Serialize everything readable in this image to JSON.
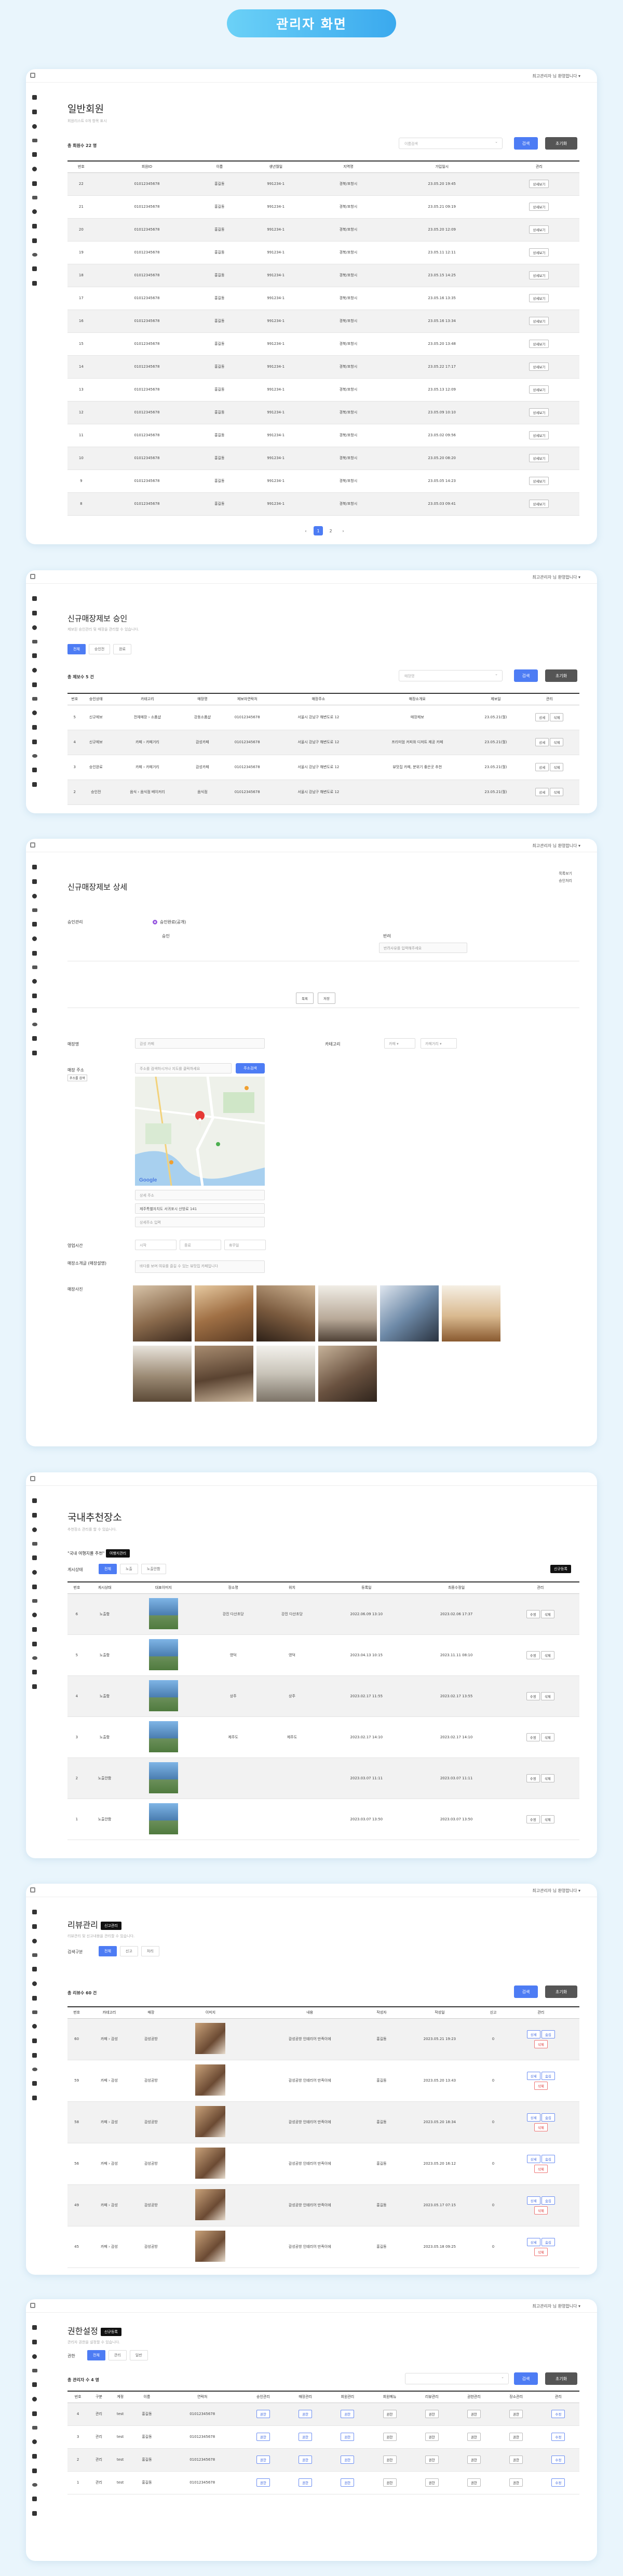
{
  "banner": "관리자 화면",
  "userinfo": "최고관리자 님 환영합니다 ▾",
  "s1": {
    "title": "일반회원",
    "sub": "회원리스트 0개 항목 표시",
    "total": "총 회원수 22 명",
    "search_placeholder": "이름검색",
    "search": "검색",
    "reset": "초기화",
    "cols": [
      "번호",
      "회원ID",
      "이름",
      "생년월일",
      "지역명",
      "가입일시",
      "관리"
    ],
    "rows": [
      [
        "22",
        "01012345678",
        "홍길동",
        "991234-1",
        "경북/포항시",
        "23.05.20 19:45"
      ],
      [
        "21",
        "01012345678",
        "홍길동",
        "991234-1",
        "경북/포항시",
        "23.05.21 09:19"
      ],
      [
        "20",
        "01012345678",
        "홍길동",
        "991234-1",
        "경북/포항시",
        "23.05.20 12:09"
      ],
      [
        "19",
        "01012345678",
        "홍길동",
        "991234-1",
        "경북/포항시",
        "23.05.11 12:11"
      ],
      [
        "18",
        "01012345678",
        "홍길동",
        "991234-1",
        "경북/포항시",
        "23.05.15 14:25"
      ],
      [
        "17",
        "01012345678",
        "홍길동",
        "991234-1",
        "경북/포항시",
        "23.05.16 13:35"
      ],
      [
        "16",
        "01012345678",
        "홍길동",
        "991234-1",
        "경북/포항시",
        "23.05.16 13:34"
      ],
      [
        "15",
        "01012345678",
        "홍길동",
        "991234-1",
        "경북/포항시",
        "23.05.20 13:48"
      ],
      [
        "14",
        "01012345678",
        "홍길동",
        "991234-1",
        "경북/포항시",
        "23.05.22 17:17"
      ],
      [
        "13",
        "01012345678",
        "홍길동",
        "991234-1",
        "경북/포항시",
        "23.05.13 12:09"
      ],
      [
        "12",
        "01012345678",
        "홍길동",
        "991234-1",
        "경북/포항시",
        "23.05.09 10:10"
      ],
      [
        "11",
        "01012345678",
        "홍길동",
        "991234-1",
        "경북/포항시",
        "23.05.02 09:56"
      ],
      [
        "10",
        "01012345678",
        "홍길동",
        "991234-1",
        "경북/포항시",
        "23.05.20 08:20"
      ],
      [
        "9",
        "01012345678",
        "홍길동",
        "991234-1",
        "경북/포항시",
        "23.05.05 14:23"
      ],
      [
        "8",
        "01012345678",
        "홍길동",
        "991234-1",
        "경북/포항시",
        "23.05.03 09:41"
      ]
    ],
    "action": "상세보기",
    "pages": [
      "‹",
      "1",
      "2",
      "›"
    ]
  },
  "s2": {
    "title": "신규매장제보 승인",
    "sub": "제보된 승인관리 및 매장을 관리할 수 있습니다.",
    "tabs": [
      "전체",
      "승인전",
      "완료"
    ],
    "total": "총 제보수 5 건",
    "search_placeholder": "매장명",
    "search": "검색",
    "reset": "초기화",
    "cols": [
      "번호",
      "승인상태",
      "카테고리",
      "매장명",
      "제보자연락처",
      "매장주소",
      "매장소개요",
      "제보일",
      "관리"
    ],
    "rows": [
      [
        "5",
        "신규제보",
        "전체매장 › 소품샵",
        "강동소품샵",
        "01012345678",
        "서울시 강남구 해변도로 12",
        "매장제보",
        "23.05.21(월)"
      ],
      [
        "4",
        "신규제보",
        "카페 › 카페거리",
        "감성카페",
        "01012345678",
        "서울시 강남구 해변도로 12",
        "프리미엄 커피와 디저트 제공 카페",
        "23.05.21(월)"
      ],
      [
        "3",
        "승인완료",
        "카페 › 카페거리",
        "감성카페",
        "01012345678",
        "서울시 강남구 해변도로 12",
        "뷰맛집 카페, 분위기 좋은곳 추천",
        "23.05.21(월)"
      ],
      [
        "2",
        "승인전",
        "음식 › 음식점 베이커리",
        "음식점",
        "01012345678",
        "서울시 강남구 해변도로 12",
        "",
        "23.05.21(월)"
      ]
    ],
    "b1": "상세",
    "b2": "삭제"
  },
  "s3": {
    "title": "신규매장제보 상세",
    "top_r1": "목록보기",
    "top_r2": "승인처리",
    "approve_label": "승인관리",
    "radio1": "승인완료(공개)",
    "radio2": "승인",
    "radio3": "반려",
    "reject_placeholder": "반려사유를 입력해주세요",
    "b_list": "목록",
    "b_save": "저장",
    "store_label": "매장명",
    "store_value": "감성 카페",
    "cat_label": "카테고리",
    "cat1": "카페 ▾",
    "cat2": "카페거리 ▾",
    "addr_label": "매장 주소",
    "addr_hint": "주소를 검색",
    "addr_placeholder": "주소를 검색하시거나 지도를 클릭하세요",
    "addr_btn": "주소검색",
    "addr1": "상세 주소",
    "addr2": "제주특별자치도 서귀포시 산방로 141",
    "addr3": "상세주소 입력",
    "time_label": "영업시간",
    "time1": "시작",
    "time2": "종료",
    "time3": "휴무일",
    "intro_label": "매장소개글 (매장설명)",
    "intro_value": "바다를 보며 여유를 즐길 수 있는 뷰맛집 카페입니다",
    "photo_label": "매장사진"
  },
  "s4": {
    "title": "국내추천장소",
    "sub": "추천장소 관리를 할 수 있습니다.",
    "note": "\"국내 여행지를 추천\"",
    "note_badge": "여행지관리",
    "filter_label": "게시상태",
    "tabs": [
      "전체",
      "노출",
      "노출안함"
    ],
    "add": "신규등록",
    "cols": [
      "번호",
      "게시상태",
      "대표이미지",
      "장소명",
      "위치",
      "등록일",
      "최종수정일",
      "관리"
    ],
    "rows": [
      [
        "6",
        "노출함",
        "강진 다산초당",
        "강진 다산초당",
        "2022.06.09 13:10",
        "2023.02.06 17:37"
      ],
      [
        "5",
        "노출함",
        "영덕",
        "영덕",
        "2023.04.13 10:15",
        "2023.11.11 08:10"
      ],
      [
        "4",
        "노출함",
        "상주",
        "상주",
        "2023.02.17 11:55",
        "2023.02.17 13:55"
      ],
      [
        "3",
        "노출함",
        "제주도",
        "제주도",
        "2023.02.17 14:10",
        "2023.02.17 14:10"
      ],
      [
        "2",
        "노출안함",
        "",
        "",
        "2023.03.07 11:11",
        "2023.03.07 11:11"
      ],
      [
        "1",
        "노출안함",
        "",
        "",
        "2023.03.07 13:50",
        "2023.03.07 13:50"
      ]
    ],
    "b1": "수정",
    "b2": "삭제"
  },
  "s5": {
    "title": "리뷰관리",
    "title_badge": "신고관리",
    "sub": "리뷰관리 및 신고내용을 관리할 수 있습니다.",
    "filter_label": "검색구분",
    "tabs": [
      "전체",
      "신고",
      "처리"
    ],
    "total": "총 리뷰수 60 건",
    "search": "검색",
    "reset": "초기화",
    "cols": [
      "번호",
      "카테고리",
      "매장",
      "이미지",
      "내용",
      "작성자",
      "작성일",
      "신고",
      "관리"
    ],
    "rows": [
      [
        "60",
        "카페 › 감성",
        "감성공방",
        "감성공방 인테리어 만족이에",
        "홍길동",
        "2023.05.21 19:23",
        "0"
      ],
      [
        "59",
        "카페 › 감성",
        "감성공방",
        "감성공방 인테리어 만족이에",
        "홍길동",
        "2023.05.20 13:43",
        "0"
      ],
      [
        "58",
        "카페 › 감성",
        "감성공방",
        "감성공방 인테리어 만족이에",
        "홍길동",
        "2023.05.20 18:34",
        "0"
      ],
      [
        "56",
        "카페 › 감성",
        "감성공방",
        "감성공방 인테리어 만족이에",
        "홍길동",
        "2023.05.20 16:12",
        "0"
      ],
      [
        "49",
        "카페 › 감성",
        "감성공방",
        "감성공방 인테리어 만족이에",
        "홍길동",
        "2023.05.17 07:15",
        "0"
      ],
      [
        "45",
        "카페 › 감성",
        "감성공방",
        "감성공방 인테리어 만족이에",
        "홍길동",
        "2023.05.18 09:25",
        "0"
      ]
    ],
    "b1": "상세",
    "b2": "숨김",
    "b3": "삭제"
  },
  "s6": {
    "title": "권한설정",
    "title_badge": "신규등록",
    "sub": "관리자 권한을 설정할 수 있습니다.",
    "filter_label": "권한",
    "tabs": [
      "전체",
      "관리",
      "일반"
    ],
    "total": "총 관리자 수 4 명",
    "search": "검색",
    "reset": "초기화",
    "cols": [
      "번호",
      "구분",
      "계정",
      "이름",
      "연락처",
      "승인관리",
      "매장관리",
      "회원관리",
      "회원메뉴",
      "리뷰관리",
      "권한관리",
      "장소관리",
      "관리"
    ],
    "rows": [
      [
        "4",
        "관리",
        "test",
        "홍길동",
        "01012345678"
      ],
      [
        "3",
        "관리",
        "test",
        "홍길동",
        "01012345678"
      ],
      [
        "2",
        "관리",
        "test",
        "홍길동",
        "01012345678"
      ],
      [
        "1",
        "관리",
        "test",
        "홍길동",
        "01012345678"
      ]
    ],
    "perm": "권한",
    "edit": "수정"
  }
}
